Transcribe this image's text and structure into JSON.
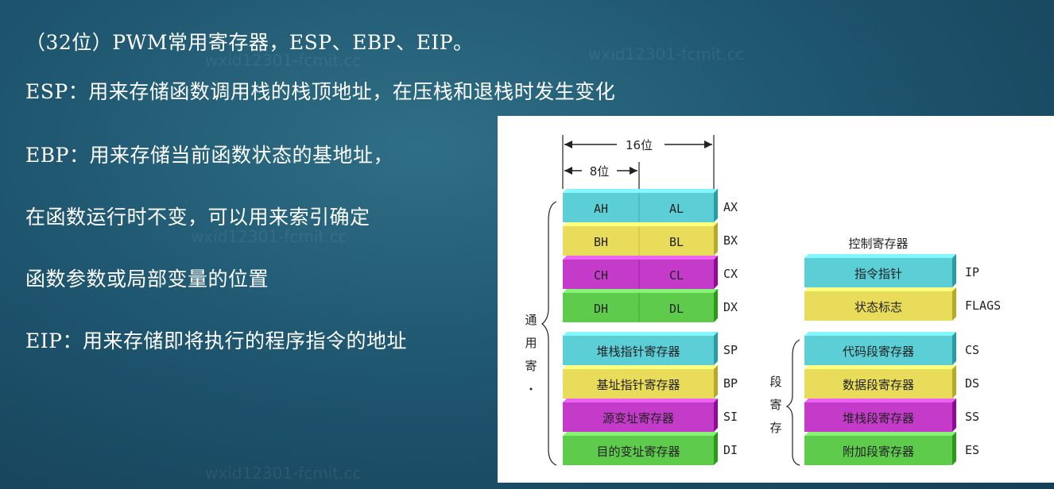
{
  "slide": {
    "lines": [
      "（32位）PWM常用寄存器，ESP、EBP、EIP。",
      "ESP：用来存储函数调用栈的栈顶地址，在压栈和退栈时发生变化",
      "EBP：用来存储当前函数状态的基地址，",
      "在函数运行时不变，可以用来索引确定",
      "函数参数或局部变量的位置",
      "EIP：用来存储即将执行的程序指令的地址"
    ],
    "watermark": "wxid12301-fcmit.cc"
  },
  "figure": {
    "width_16": "16位",
    "width_8": "8位",
    "general_group": "通用寄",
    "general_rows": [
      {
        "high": "AH",
        "low": "AL",
        "name": "AX",
        "color": "#5ccfd6"
      },
      {
        "high": "BH",
        "low": "BL",
        "name": "BX",
        "color": "#e8dc5a"
      },
      {
        "high": "CH",
        "low": "CL",
        "name": "CX",
        "color": "#c43bc9"
      },
      {
        "high": "DH",
        "low": "DL",
        "name": "DX",
        "color": "#5fcb4c"
      }
    ],
    "pointer_rows": [
      {
        "label": "堆栈指针寄存器",
        "name": "SP",
        "color": "#5ccfd6"
      },
      {
        "label": "基址指针寄存器",
        "name": "BP",
        "color": "#e8dc5a"
      },
      {
        "label": "源变址寄存器",
        "name": "SI",
        "color": "#c43bc9"
      },
      {
        "label": "目的变址寄存器",
        "name": "DI",
        "color": "#5fcb4c"
      }
    ],
    "control_title": "控制寄存器",
    "control_rows": [
      {
        "label": "指令指针",
        "name": "IP",
        "color": "#5ccfd6"
      },
      {
        "label": "状态标志",
        "name": "FLAGS",
        "color": "#e8dc5a"
      }
    ],
    "segment_group": "段寄存",
    "segment_rows": [
      {
        "label": "代码段寄存器",
        "name": "CS",
        "color": "#5ccfd6"
      },
      {
        "label": "数据段寄存器",
        "name": "DS",
        "color": "#e8dc5a"
      },
      {
        "label": "堆栈段寄存器",
        "name": "SS",
        "color": "#c43bc9"
      },
      {
        "label": "附加段寄存器",
        "name": "ES",
        "color": "#5fcb4c"
      }
    ]
  }
}
